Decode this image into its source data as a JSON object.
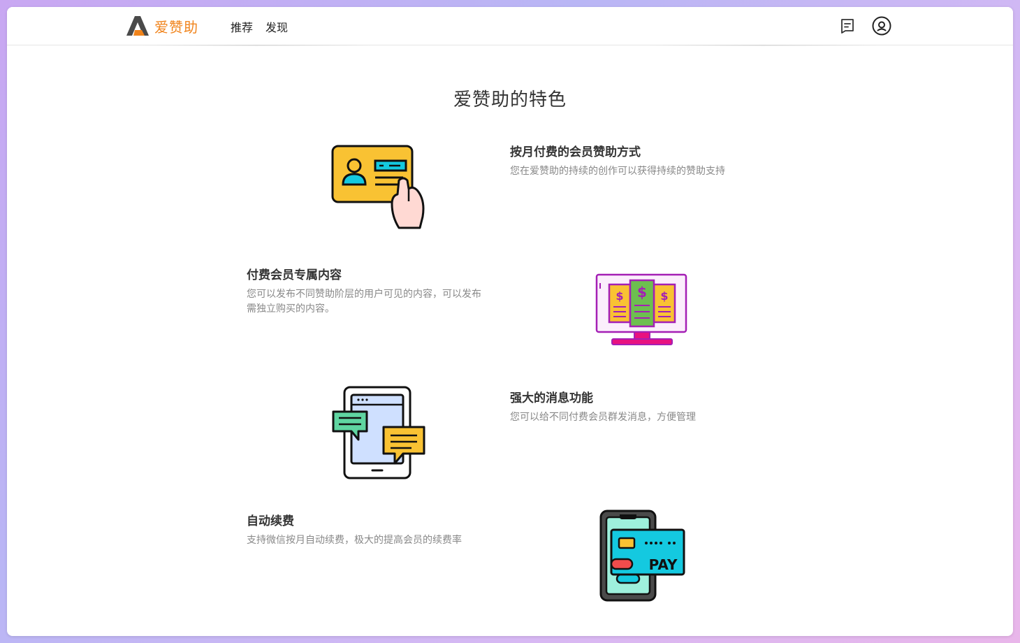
{
  "header": {
    "brand": "爱赞助",
    "nav": [
      {
        "label": "推荐"
      },
      {
        "label": "发现"
      }
    ],
    "icons": [
      "message-icon",
      "user-icon"
    ]
  },
  "main": {
    "title": "爱赞助的特色",
    "features": [
      {
        "title": "按月付费的会员赞助方式",
        "desc": "您在爱赞助的持续的创作可以获得持续的赞助支持",
        "icon": "membership-card-icon"
      },
      {
        "title": "付费会员专属内容",
        "desc_line1": "您可以发布不同赞助阶层的用户可见的内容，可以发布",
        "desc_line2": "需独立购买的内容。",
        "icon": "paid-content-monitor-icon"
      },
      {
        "title": "强大的消息功能",
        "desc": "您可以给不同付费会员群发消息，方便管理",
        "icon": "tablet-chat-icon"
      },
      {
        "title": "自动续费",
        "desc": "支持微信按月自动续费，极大的提高会员的续费率",
        "icon": "phone-pay-card-icon",
        "pay_label": "PAY"
      }
    ]
  },
  "colors": {
    "brand": "#f0831b",
    "text_dark": "#333333",
    "text_muted": "#888888"
  }
}
